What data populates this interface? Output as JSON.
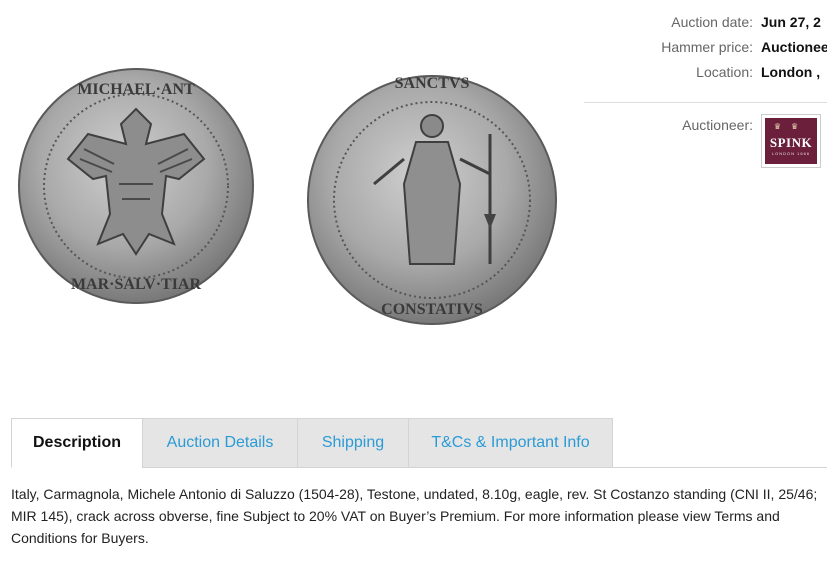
{
  "lot": {
    "image_alt": "Italy, Carmagnola, Michele Antonio di Saluzzo Testone, obverse and reverse",
    "obverse_legend": "MICHAEL ANT MAR SALV TIAR",
    "reverse_legend": "SANCTVS CONSTATIVS"
  },
  "meta": {
    "rows": [
      {
        "label": "Auction date:",
        "value": "Jun 27, 2"
      },
      {
        "label": "Hammer price:",
        "value": "Auctioneer"
      },
      {
        "label": "Location:",
        "value": "London ,"
      }
    ],
    "auctioneer_label": "Auctioneer:",
    "auctioneer_logo": {
      "name": "SPINK",
      "sub": "LONDON 1666",
      "color": "#6b1f3a"
    }
  },
  "tabs": [
    {
      "label": "Description",
      "active": true
    },
    {
      "label": "Auction Details",
      "active": false
    },
    {
      "label": "Shipping",
      "active": false
    },
    {
      "label": "T&Cs & Important Info",
      "active": false
    }
  ],
  "description": "Italy, Carmagnola, Michele Antonio di Saluzzo (1504-28), Testone, undated, 8.10g, eagle, rev. St Costanzo standing (CNI II, 25/46; MIR 145), crack across obverse, fine Subject to 20% VAT on Buyer’s Premium. For more information please view Terms and Conditions for Buyers.",
  "colors": {
    "tab_link": "#2a9bd6",
    "tab_bg": "#e5e5e5"
  }
}
